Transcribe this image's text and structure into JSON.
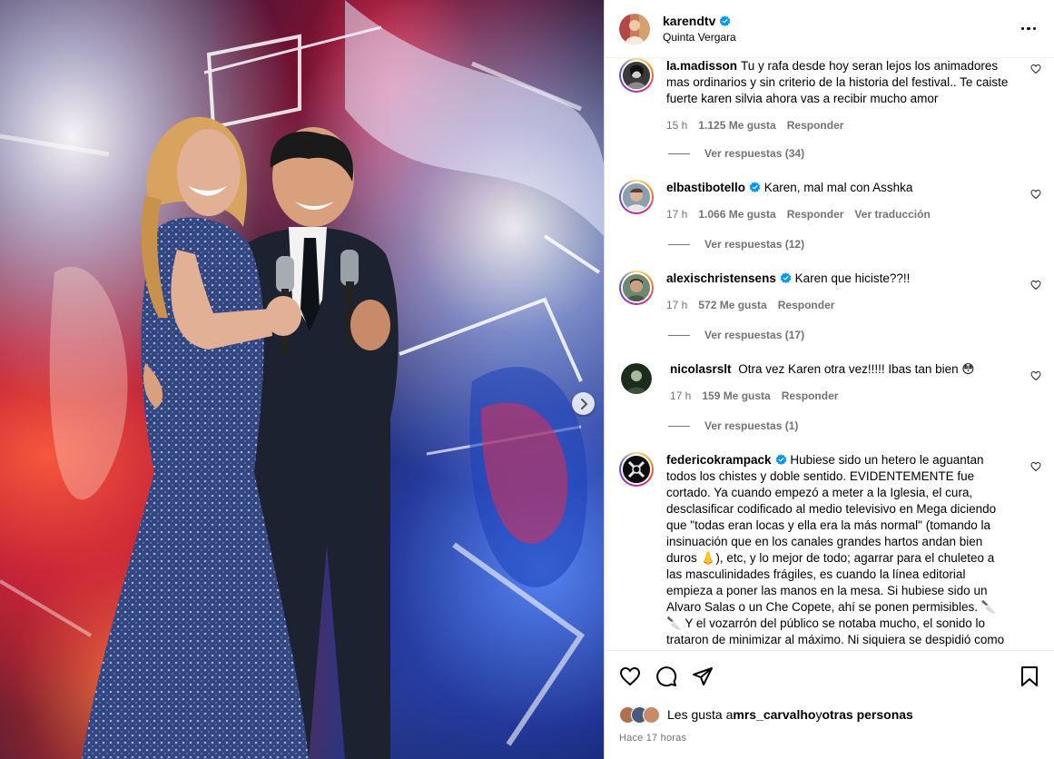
{
  "post": {
    "username": "karendtv",
    "location": "Quinta Vergara",
    "verified": true
  },
  "icons": {
    "more": "more-options-icon",
    "next": "chevron-right-icon",
    "like": "heart-icon",
    "comment": "comment-bubble-icon",
    "share": "paper-plane-icon",
    "save": "bookmark-icon",
    "verified": "verified-badge-icon"
  },
  "comments": [
    {
      "user": "la.madisson",
      "verified": false,
      "text": "Tu y rafa desde hoy seran lejos los animadores mas ordinarios y sin criterio de la historia del festival.. Te caiste fuerte karen silvia ahora vas a recibir mucho amor",
      "time": "15 h",
      "likes": "1.125 Me gusta",
      "reply": "Responder",
      "translate": "",
      "replies": "Ver respuestas (34)"
    },
    {
      "user": "elbastibotello",
      "verified": true,
      "text": "Karen, mal mal con Asshka",
      "time": "17 h",
      "likes": "1.066 Me gusta",
      "reply": "Responder",
      "translate": "Ver traducción",
      "replies": "Ver respuestas (12)"
    },
    {
      "user": "alexischristensens",
      "verified": true,
      "text": "Karen que hiciste??!!",
      "time": "17 h",
      "likes": "572 Me gusta",
      "reply": "Responder",
      "translate": "",
      "replies": "Ver respuestas (17)"
    },
    {
      "user": "nicolasrslt",
      "verified": false,
      "text": "Otra vez Karen otra vez!!!!! Ibas tan bien 😳",
      "time": "17 h",
      "likes": "159 Me gusta",
      "reply": "Responder",
      "translate": "",
      "replies": "Ver respuestas (1)"
    },
    {
      "user": "federicokrampack",
      "verified": true,
      "text": "Hubiese sido un hetero le aguantan todos los chistes y doble sentido. EVIDENTEMENTE fue cortado. Ya cuando empezó a meter a la Iglesia, el cura, desclasificar codificado al medio televisivo en Mega diciendo que \"todas eran locas y ella era la más normal\" (tomando la insinuación que en los canales grandes hartos andan bien duros 👃), etc, y lo mejor de todo; agarrar para el chuleteo a las masculinidades frágiles, es cuando la línea editorial empieza a poner las manos en la mesa. Si hubiese sido un Alvaro Salas o un Che Copete, ahí se ponen permisibles. 🔪🔪 Y el vozarrón del público se notaba mucho, el sonido lo trataron de minimizar al máximo. Ni siquiera se despidió como los demás humoristas ni tampoco tuvo un segundo tiempo de chistes. No",
      "time": "",
      "likes": "",
      "reply": "",
      "translate": "",
      "replies": ""
    }
  ],
  "likes_bar": {
    "prefix": "Les gusta a ",
    "user": "mrs_carvalho",
    "middle": " y ",
    "others": "otras personas"
  },
  "timestamp": "Hace 17 horas",
  "colors": {
    "meta": "#737373",
    "verified": "#0095f6",
    "border": "#dbdbdb"
  }
}
